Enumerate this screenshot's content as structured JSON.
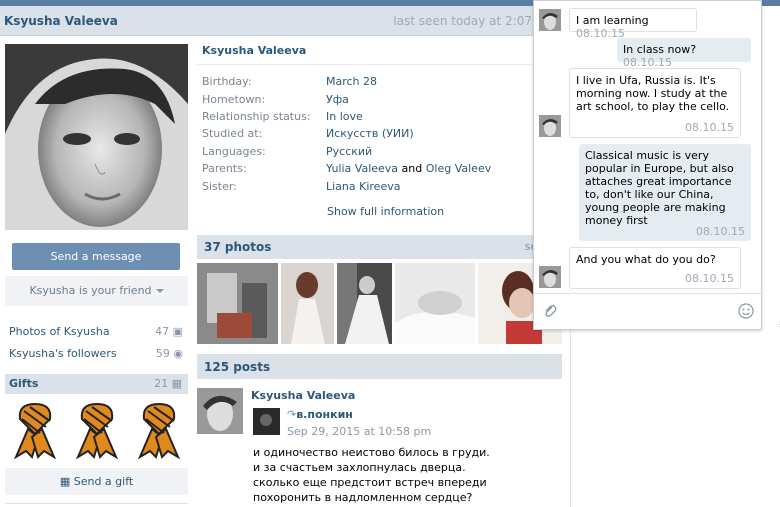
{
  "header": {
    "name": "Ksyusha Valeeva",
    "last_seen": "last seen today at 2:07"
  },
  "left": {
    "send_message": "Send a message",
    "friend_status": "Ksyusha is your friend",
    "photos_of": {
      "label": "Photos of Ksyusha",
      "count": "47"
    },
    "followers": {
      "label": "Ksyusha's followers",
      "count": "59"
    },
    "gifts": {
      "label": "Gifts",
      "count": "21"
    },
    "send_gift": "Send a gift"
  },
  "info": {
    "name": "Ksyusha Valeeva",
    "rows": [
      {
        "label": "Birthday:",
        "value": "March 28"
      },
      {
        "label": "Hometown:",
        "value": "Уфа"
      },
      {
        "label": "Relationship status:",
        "value": "In love"
      },
      {
        "label": "Studied at:",
        "value": "Искусств (УИИ)"
      },
      {
        "label": "Languages:",
        "value": "Русский"
      },
      {
        "label": "Parents:",
        "value": "Yulia Valeeva",
        "and": "and",
        "value2": "Oleg Valeev"
      },
      {
        "label": "Sister:",
        "value": "Liana Kireeva"
      }
    ],
    "show_full": "Show full information"
  },
  "photos": {
    "title": "37 photos",
    "see_all": "see"
  },
  "posts": {
    "title": "125 posts",
    "author": "Ksyusha Valeeva",
    "repost_name": "в.понкин",
    "repost_date": "Sep 29, 2015 at 10:58 pm",
    "text_lines": [
      "и одиночество неистово билось в груди.",
      "и за счастьем захлопнулась дверца.",
      "сколько еще предстоит встреч впереди",
      "похоронить в надломленном сердце?"
    ]
  },
  "chat": {
    "messages": [
      {
        "dir": "in",
        "text": "I am learning",
        "time": "08.10.15"
      },
      {
        "dir": "out",
        "text": "In class now?",
        "time": "08.10.15"
      },
      {
        "dir": "in",
        "text": "I live in Ufa, Russia is. It's morning now. I study at the art school, to play the cello.",
        "time": "08.10.15"
      },
      {
        "dir": "out",
        "text": "Classical music is very popular in Europe, but also attaches great importance to, don't like our China, young people are making money first",
        "time": "08.10.15"
      },
      {
        "dir": "in",
        "text": "And you what do you do?",
        "time": "08.10.15"
      }
    ]
  },
  "colors": {
    "brand": "#597da3",
    "link": "#2b587a",
    "button": "#6d8fb3",
    "panel": "#dae1e8"
  },
  "icons": [
    "camera-icon",
    "followers-icon",
    "gift-icon",
    "chevron-down-icon",
    "repost-arrow-icon",
    "paperclip-icon",
    "smiley-icon",
    "ribbon-icon"
  ]
}
